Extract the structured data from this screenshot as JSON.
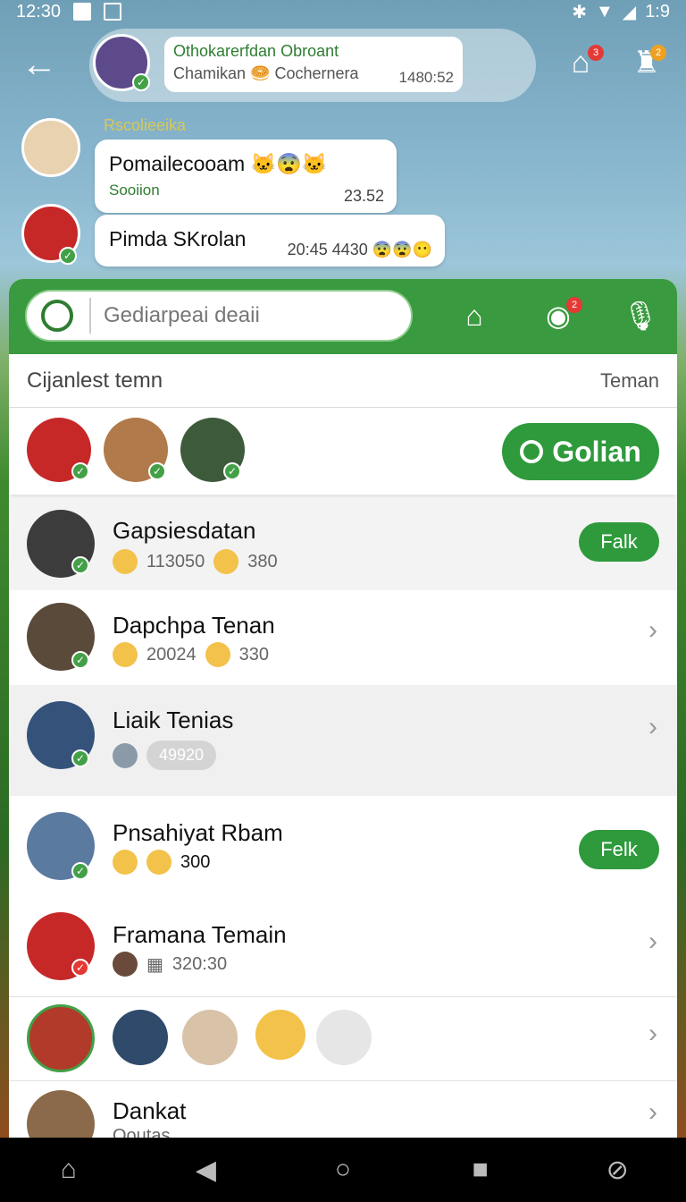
{
  "status": {
    "time": "12:30",
    "right": "1:9"
  },
  "header": {
    "chip_title": "Othokarerfdan Obroant",
    "chip_sub": "Chamikan 🥯 Cochernera",
    "chip_time": "1480:52",
    "home_badge": "3",
    "pin_badge": "2"
  },
  "chat": {
    "sender": "Rscolieeika",
    "messages": [
      {
        "text": "Pomailecooam 🐱😨🐱",
        "sub": "Sooiion",
        "time": "23.52"
      },
      {
        "text": "Pimda SKrolan",
        "time": "20:45 4430 😨😨😶"
      }
    ]
  },
  "search": {
    "placeholder": "Gediarpeai deaii",
    "cam_badge": "2"
  },
  "section": {
    "title": "Cijanlest temn",
    "action": "Teman"
  },
  "strip": {
    "button": "Golian"
  },
  "rows": [
    {
      "name": "Gapsiesdatan",
      "a": "113050",
      "b": "380",
      "action": "Falk"
    },
    {
      "name": "Dapchpa Tenan",
      "a": "20024",
      "b": "330"
    },
    {
      "name": "Liaik Tenias",
      "tag": "49920"
    },
    {
      "name": "Pnsahiyat Rbam",
      "b": "300",
      "action": "Felk"
    },
    {
      "name": "Framana Temain",
      "tag": "320:30"
    },
    {
      "name": "Dankat",
      "sub": "Ooutas"
    }
  ],
  "colors": {
    "green": "#2e9a3c",
    "accent": "#43a047"
  },
  "icons": [
    "back-arrow-icon",
    "home-icon",
    "pin-icon",
    "search-icon",
    "house-outline-icon",
    "camera-icon",
    "mic-icon",
    "chevron-right-icon"
  ]
}
